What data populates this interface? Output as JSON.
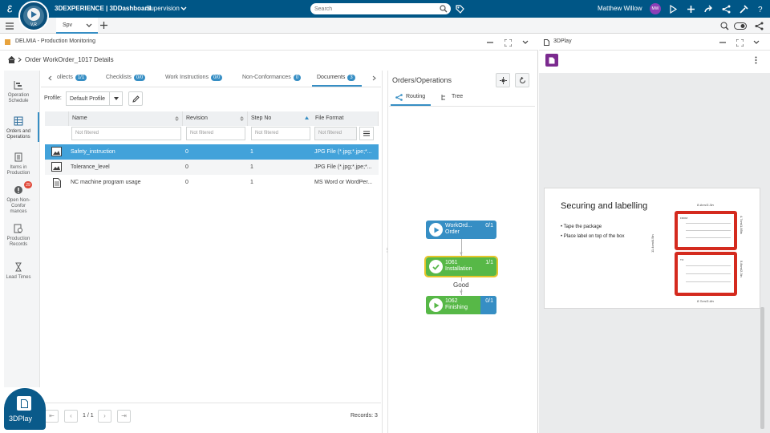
{
  "topbar": {
    "brand": "3DEXPERIENCE | 3DDashboard",
    "dashboard": "Supervision",
    "search_placeholder": "Search",
    "user": "Matthew Willow",
    "avatar_initials": "MW",
    "compass_label": "V,R"
  },
  "tabs": [
    {
      "label": "Spv"
    }
  ],
  "left_panel": {
    "title": "DELMIA - Production Monitoring",
    "breadcrumb": "Order WorkOrder_1017 Details",
    "nav": [
      {
        "label": "Operation Schedule",
        "icon": "schedule-icon"
      },
      {
        "label": "Orders and Operations",
        "icon": "grid-icon"
      },
      {
        "label": "Items in Production",
        "icon": "items-icon"
      },
      {
        "label": "Open Non-Confor mances",
        "icon": "alert-icon",
        "badge": "29"
      },
      {
        "label": "Production Records",
        "icon": "records-icon"
      },
      {
        "label": "Lead Times",
        "icon": "hourglass-icon"
      }
    ],
    "tabs": [
      {
        "label": "ollects",
        "count": "1/1"
      },
      {
        "label": "Checklists",
        "count": "0/0"
      },
      {
        "label": "Work Instructions",
        "count": "0/0"
      },
      {
        "label": "Non-Conformances",
        "count": "0"
      },
      {
        "label": "Documents",
        "count": "3"
      }
    ],
    "profile_label": "Profile:",
    "profile_value": "Default Profile",
    "columns": [
      "Name",
      "Revision",
      "Step No",
      "File Format"
    ],
    "filter_placeholder": "Not filtered",
    "rows": [
      {
        "name": "Safety_instruction",
        "revision": "0",
        "step": "1",
        "format": "JPG File (*.jpg;*.jpe;*..."
      },
      {
        "name": "Tolerance_level",
        "revision": "0",
        "step": "1",
        "format": "JPG File (*.jpg;*.jpe;*..."
      },
      {
        "name": "NC machine program usage",
        "revision": "0",
        "step": "1",
        "format": "MS Word or WordPer..."
      }
    ],
    "pager": "1 / 1",
    "records": "Records: 3"
  },
  "orders_panel": {
    "title": "Orders/Operations",
    "tab_routing": "Routing",
    "tab_tree": "Tree",
    "nodes": [
      {
        "line1": "WorkOrd...",
        "line2": "Order",
        "qty": "0/1",
        "color": "#368ec4"
      },
      {
        "line1": "1061",
        "line2": "Installation",
        "qty": "1/1",
        "color": "#57b847"
      },
      {
        "line1": "1062",
        "line2": "Finishing",
        "qty": "0/1",
        "color": "#57b847"
      }
    ],
    "edge_label": "Good"
  },
  "play_panel": {
    "title": "3DPlay",
    "doc_title": "Securing and labelling",
    "bullets": [
      "Tape the package",
      "Place label on top of the box"
    ],
    "dims": {
      "top": "8.4cm/3.3in",
      "bottom": "8.7cm/3.4in",
      "left": "11.4cm/4.5in",
      "right_top": "4.7cm/1.85in",
      "right_bottom": "5.8cm/2.3in"
    },
    "label_from": "FROM:",
    "label_to": "TO:"
  },
  "launcher": {
    "label": "3DPlay"
  },
  "colors": {
    "brand": "#005686",
    "accent": "#368ec4",
    "green": "#57b847",
    "selected_row": "#42a2da",
    "label_red": "#d42a1e"
  }
}
